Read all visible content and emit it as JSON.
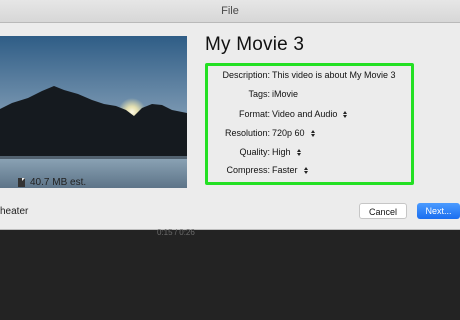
{
  "window": {
    "title": "File"
  },
  "preview": {
    "file_size": "40.7 MB est.",
    "theater_label": "heater"
  },
  "movie": {
    "title": "My Movie 3"
  },
  "fields": [
    {
      "label": "Description:",
      "value": "This video is about My Movie 3",
      "stepper": false
    },
    {
      "label": "Tags:",
      "value": "iMovie",
      "stepper": false
    },
    {
      "label": "Format:",
      "value": "Video and Audio",
      "stepper": true
    },
    {
      "label": "Resolution:",
      "value": "720p 60",
      "stepper": true
    },
    {
      "label": "Quality:",
      "value": "High",
      "stepper": true
    },
    {
      "label": "Compress:",
      "value": "Faster",
      "stepper": true
    }
  ],
  "buttons": {
    "cancel": "Cancel",
    "next": "Next..."
  },
  "playback": {
    "time": "0:15 / 0:26"
  },
  "colors": {
    "highlight": "#23e023",
    "primary_button": "#1a6ef0"
  }
}
